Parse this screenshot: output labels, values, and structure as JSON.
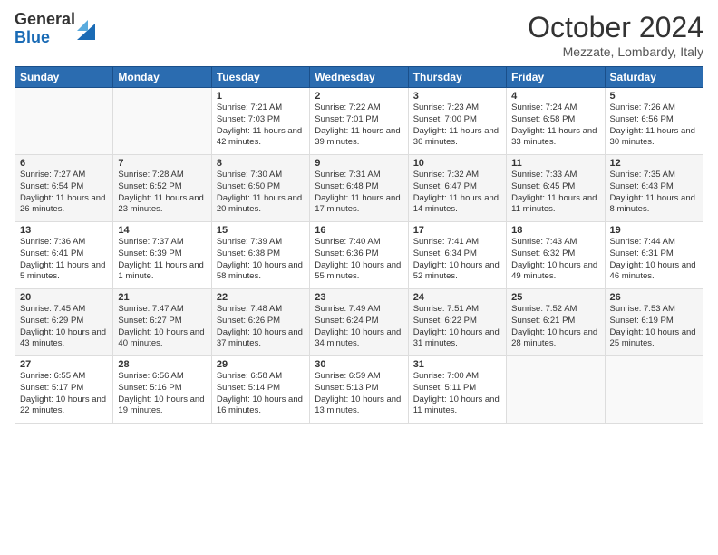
{
  "logo": {
    "general": "General",
    "blue": "Blue"
  },
  "title": "October 2024",
  "subtitle": "Mezzate, Lombardy, Italy",
  "headers": [
    "Sunday",
    "Monday",
    "Tuesday",
    "Wednesday",
    "Thursday",
    "Friday",
    "Saturday"
  ],
  "weeks": [
    [
      {
        "day": "",
        "sunrise": "",
        "sunset": "",
        "daylight": ""
      },
      {
        "day": "",
        "sunrise": "",
        "sunset": "",
        "daylight": ""
      },
      {
        "day": "1",
        "sunrise": "Sunrise: 7:21 AM",
        "sunset": "Sunset: 7:03 PM",
        "daylight": "Daylight: 11 hours and 42 minutes."
      },
      {
        "day": "2",
        "sunrise": "Sunrise: 7:22 AM",
        "sunset": "Sunset: 7:01 PM",
        "daylight": "Daylight: 11 hours and 39 minutes."
      },
      {
        "day": "3",
        "sunrise": "Sunrise: 7:23 AM",
        "sunset": "Sunset: 7:00 PM",
        "daylight": "Daylight: 11 hours and 36 minutes."
      },
      {
        "day": "4",
        "sunrise": "Sunrise: 7:24 AM",
        "sunset": "Sunset: 6:58 PM",
        "daylight": "Daylight: 11 hours and 33 minutes."
      },
      {
        "day": "5",
        "sunrise": "Sunrise: 7:26 AM",
        "sunset": "Sunset: 6:56 PM",
        "daylight": "Daylight: 11 hours and 30 minutes."
      }
    ],
    [
      {
        "day": "6",
        "sunrise": "Sunrise: 7:27 AM",
        "sunset": "Sunset: 6:54 PM",
        "daylight": "Daylight: 11 hours and 26 minutes."
      },
      {
        "day": "7",
        "sunrise": "Sunrise: 7:28 AM",
        "sunset": "Sunset: 6:52 PM",
        "daylight": "Daylight: 11 hours and 23 minutes."
      },
      {
        "day": "8",
        "sunrise": "Sunrise: 7:30 AM",
        "sunset": "Sunset: 6:50 PM",
        "daylight": "Daylight: 11 hours and 20 minutes."
      },
      {
        "day": "9",
        "sunrise": "Sunrise: 7:31 AM",
        "sunset": "Sunset: 6:48 PM",
        "daylight": "Daylight: 11 hours and 17 minutes."
      },
      {
        "day": "10",
        "sunrise": "Sunrise: 7:32 AM",
        "sunset": "Sunset: 6:47 PM",
        "daylight": "Daylight: 11 hours and 14 minutes."
      },
      {
        "day": "11",
        "sunrise": "Sunrise: 7:33 AM",
        "sunset": "Sunset: 6:45 PM",
        "daylight": "Daylight: 11 hours and 11 minutes."
      },
      {
        "day": "12",
        "sunrise": "Sunrise: 7:35 AM",
        "sunset": "Sunset: 6:43 PM",
        "daylight": "Daylight: 11 hours and 8 minutes."
      }
    ],
    [
      {
        "day": "13",
        "sunrise": "Sunrise: 7:36 AM",
        "sunset": "Sunset: 6:41 PM",
        "daylight": "Daylight: 11 hours and 5 minutes."
      },
      {
        "day": "14",
        "sunrise": "Sunrise: 7:37 AM",
        "sunset": "Sunset: 6:39 PM",
        "daylight": "Daylight: 11 hours and 1 minute."
      },
      {
        "day": "15",
        "sunrise": "Sunrise: 7:39 AM",
        "sunset": "Sunset: 6:38 PM",
        "daylight": "Daylight: 10 hours and 58 minutes."
      },
      {
        "day": "16",
        "sunrise": "Sunrise: 7:40 AM",
        "sunset": "Sunset: 6:36 PM",
        "daylight": "Daylight: 10 hours and 55 minutes."
      },
      {
        "day": "17",
        "sunrise": "Sunrise: 7:41 AM",
        "sunset": "Sunset: 6:34 PM",
        "daylight": "Daylight: 10 hours and 52 minutes."
      },
      {
        "day": "18",
        "sunrise": "Sunrise: 7:43 AM",
        "sunset": "Sunset: 6:32 PM",
        "daylight": "Daylight: 10 hours and 49 minutes."
      },
      {
        "day": "19",
        "sunrise": "Sunrise: 7:44 AM",
        "sunset": "Sunset: 6:31 PM",
        "daylight": "Daylight: 10 hours and 46 minutes."
      }
    ],
    [
      {
        "day": "20",
        "sunrise": "Sunrise: 7:45 AM",
        "sunset": "Sunset: 6:29 PM",
        "daylight": "Daylight: 10 hours and 43 minutes."
      },
      {
        "day": "21",
        "sunrise": "Sunrise: 7:47 AM",
        "sunset": "Sunset: 6:27 PM",
        "daylight": "Daylight: 10 hours and 40 minutes."
      },
      {
        "day": "22",
        "sunrise": "Sunrise: 7:48 AM",
        "sunset": "Sunset: 6:26 PM",
        "daylight": "Daylight: 10 hours and 37 minutes."
      },
      {
        "day": "23",
        "sunrise": "Sunrise: 7:49 AM",
        "sunset": "Sunset: 6:24 PM",
        "daylight": "Daylight: 10 hours and 34 minutes."
      },
      {
        "day": "24",
        "sunrise": "Sunrise: 7:51 AM",
        "sunset": "Sunset: 6:22 PM",
        "daylight": "Daylight: 10 hours and 31 minutes."
      },
      {
        "day": "25",
        "sunrise": "Sunrise: 7:52 AM",
        "sunset": "Sunset: 6:21 PM",
        "daylight": "Daylight: 10 hours and 28 minutes."
      },
      {
        "day": "26",
        "sunrise": "Sunrise: 7:53 AM",
        "sunset": "Sunset: 6:19 PM",
        "daylight": "Daylight: 10 hours and 25 minutes."
      }
    ],
    [
      {
        "day": "27",
        "sunrise": "Sunrise: 6:55 AM",
        "sunset": "Sunset: 5:17 PM",
        "daylight": "Daylight: 10 hours and 22 minutes."
      },
      {
        "day": "28",
        "sunrise": "Sunrise: 6:56 AM",
        "sunset": "Sunset: 5:16 PM",
        "daylight": "Daylight: 10 hours and 19 minutes."
      },
      {
        "day": "29",
        "sunrise": "Sunrise: 6:58 AM",
        "sunset": "Sunset: 5:14 PM",
        "daylight": "Daylight: 10 hours and 16 minutes."
      },
      {
        "day": "30",
        "sunrise": "Sunrise: 6:59 AM",
        "sunset": "Sunset: 5:13 PM",
        "daylight": "Daylight: 10 hours and 13 minutes."
      },
      {
        "day": "31",
        "sunrise": "Sunrise: 7:00 AM",
        "sunset": "Sunset: 5:11 PM",
        "daylight": "Daylight: 10 hours and 11 minutes."
      },
      {
        "day": "",
        "sunrise": "",
        "sunset": "",
        "daylight": ""
      },
      {
        "day": "",
        "sunrise": "",
        "sunset": "",
        "daylight": ""
      }
    ]
  ]
}
